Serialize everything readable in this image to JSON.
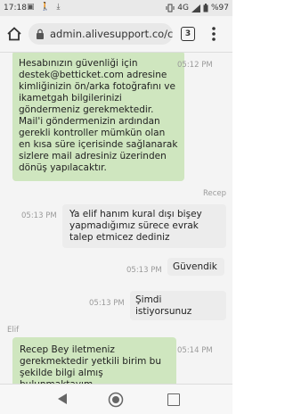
{
  "status_bar": {
    "time": "17:18",
    "network": "4G",
    "battery": "%97",
    "status_icons": [
      "sim-icon",
      "walk-icon",
      "download-icon"
    ]
  },
  "browser": {
    "url": "admin.alivesupport.co/c",
    "tab_count": "3"
  },
  "chat": {
    "messages": [
      {
        "side": "left",
        "text": "Hesabınızın güvenliği için destek@betticket.com adresine kimliğinizin ön/arka fotoğrafını ve ikametgah bilgilerinizi göndermeniz gerekmektedir. Mail'i göndermenizin ardından gerekli kontroller mümkün olan en kısa süre içerisinde sağlanarak sizlere mail adresiniz üzerinden dönüş yapılacaktır.",
        "time": "05:12 PM"
      },
      {
        "side": "right",
        "sender": "Recep",
        "text": "Ya elif hanım kural dışı bişey yapmadığımız sürece evrak talep etmicez dediniz",
        "time": "05:13 PM"
      },
      {
        "side": "right",
        "text": "Güvendik",
        "time": "05:13 PM"
      },
      {
        "side": "right",
        "text": "Şimdi istiyorsunuz",
        "time": "05:13 PM"
      },
      {
        "side": "left",
        "sender": "Elif",
        "text": "Recep Bey iletmeniz gerekmektedir yetkili birim bu şekilde bilgi almış bulunmaktayım",
        "time": "05:14 PM"
      }
    ]
  }
}
